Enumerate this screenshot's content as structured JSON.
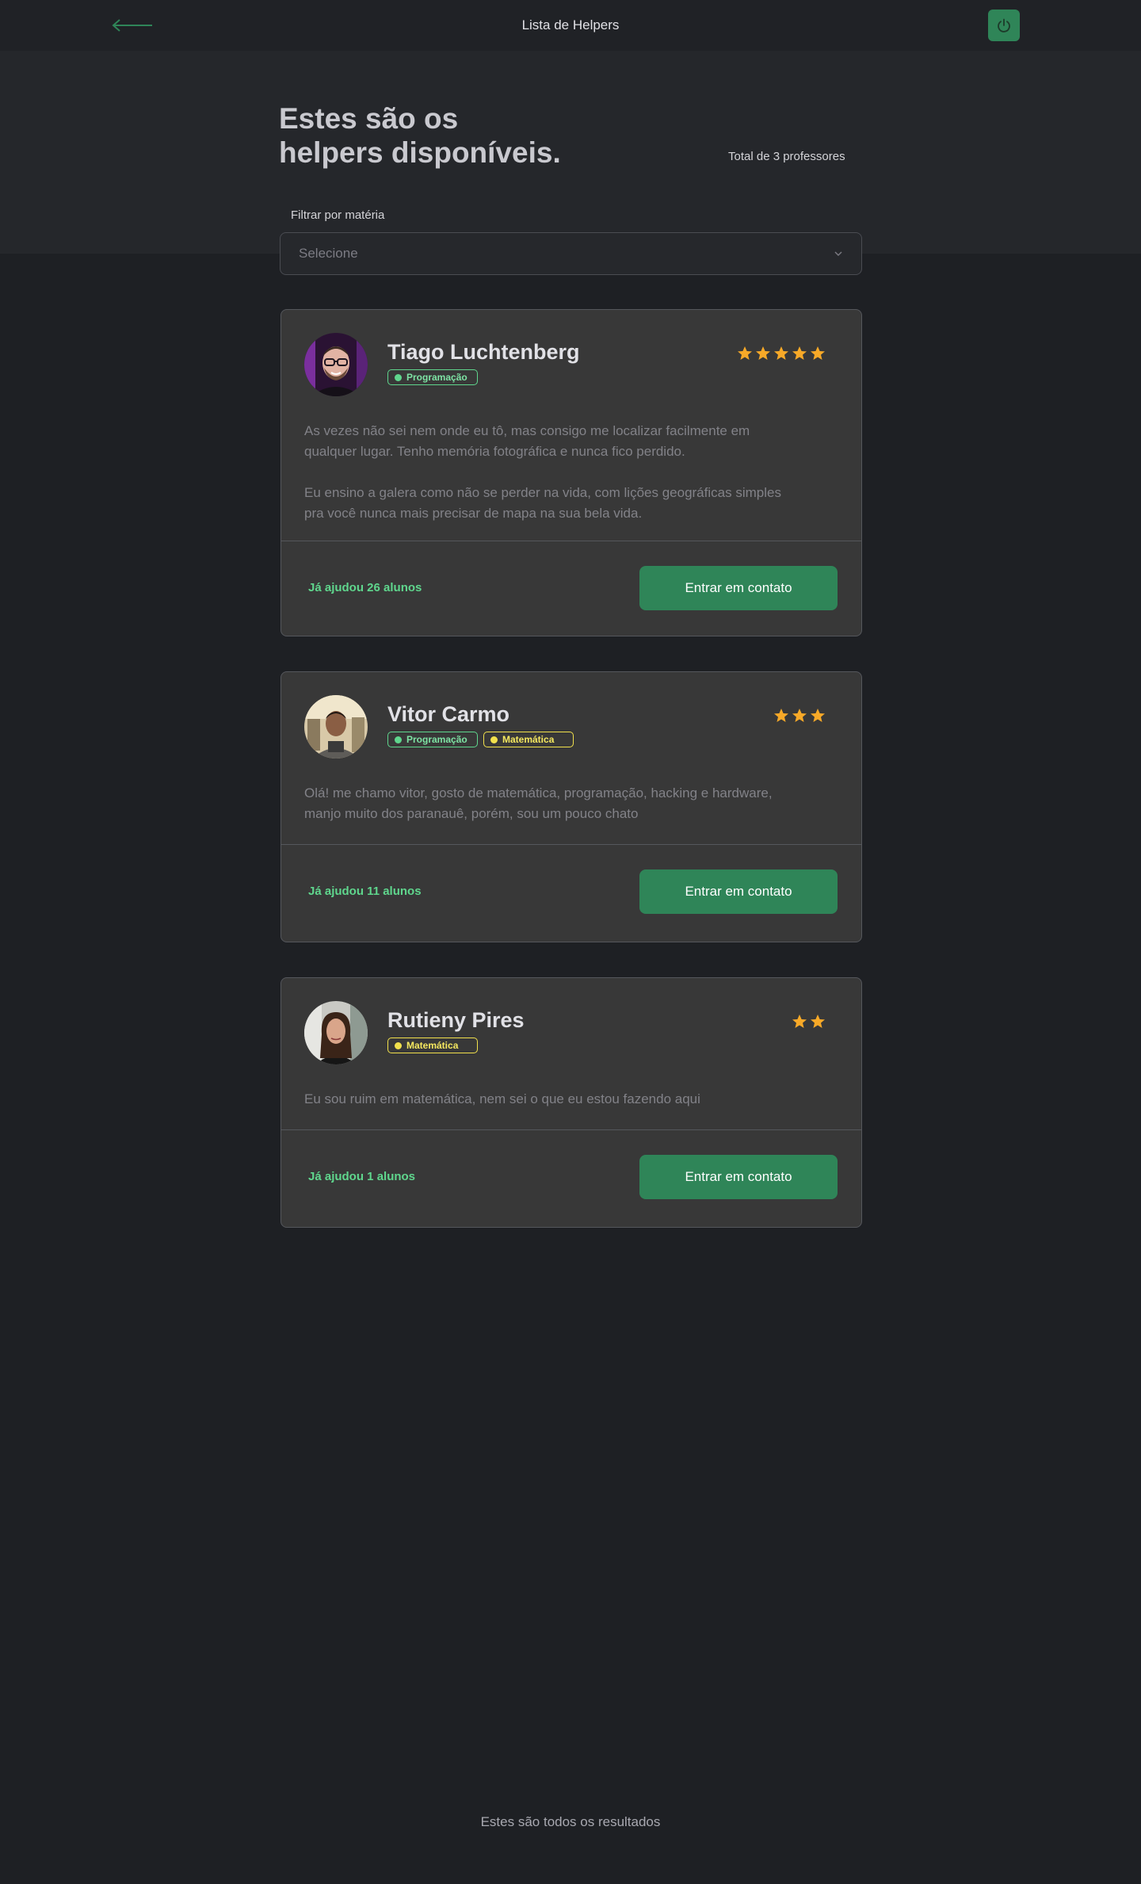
{
  "topbar": {
    "title": "Lista de Helpers",
    "back_icon": "arrow-left-icon",
    "logout_icon": "power-icon",
    "accent": "#2f8558"
  },
  "hero": {
    "title_line1": "Estes são os",
    "title_line2": "helpers disponíveis.",
    "total": "Total de 3 professores"
  },
  "filter": {
    "label": "Filtrar por matéria",
    "placeholder": "Selecione"
  },
  "helpers": [
    {
      "name": "Tiago Luchtenberg",
      "tags": [
        {
          "label": "Programação",
          "color": "green"
        }
      ],
      "rating": 5,
      "description": [
        "As vezes não sei nem onde eu tô, mas consigo me localizar facilmente em qualquer lugar. Tenho memória fotográfica e nunca fico perdido.",
        "Eu ensino a galera como não se perder na vida, com lições geográficas simples pra você nunca mais precisar de mapa na sua bela vida."
      ],
      "helped": "Já ajudou 26 alunos",
      "button": "Entrar em contato"
    },
    {
      "name": "Vitor Carmo",
      "tags": [
        {
          "label": "Programação",
          "color": "green"
        },
        {
          "label": "Matemática",
          "color": "yellow"
        }
      ],
      "rating": 3,
      "description": [
        "Olá! me chamo vitor, gosto de matemática, programação, hacking e hardware, manjo muito dos paranauê, porém, sou um pouco chato"
      ],
      "helped": "Já ajudou 11 alunos",
      "button": "Entrar em contato"
    },
    {
      "name": "Rutieny Pires",
      "tags": [
        {
          "label": "Matemática",
          "color": "yellow"
        }
      ],
      "rating": 2,
      "description": [
        "Eu sou ruim em matemática, nem sei o que eu estou fazendo aqui"
      ],
      "helped": "Já ajudou 1 alunos",
      "button": "Entrar em contato"
    }
  ],
  "footer": {
    "text": "Estes são todos os resultados"
  },
  "colors": {
    "green": "#5fd68d",
    "yellow": "#f2e14c",
    "star": "#f7a928"
  }
}
